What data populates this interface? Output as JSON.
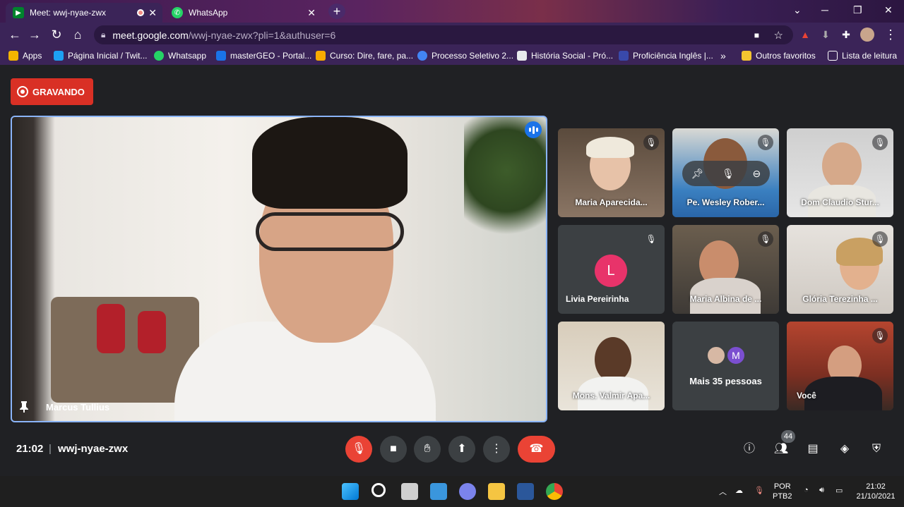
{
  "browser": {
    "tabs": [
      {
        "title": "Meet: wwj-nyae-zwx",
        "icon": "meet-icon",
        "active": true
      },
      {
        "title": "WhatsApp",
        "icon": "whatsapp-icon",
        "active": false
      }
    ],
    "url_host": "meet.google.com",
    "url_path": "/wwj-nyae-zwx?pli=1&authuser=6",
    "bookmarks": [
      {
        "label": "Apps",
        "icon": "apps-grid-icon",
        "color": "#f4b400"
      },
      {
        "label": "Página Inicial / Twit...",
        "icon": "twitter-icon",
        "color": "#1da1f2"
      },
      {
        "label": "Whatsapp",
        "icon": "whatsapp-icon",
        "color": "#25d366"
      },
      {
        "label": "masterGEO - Portal...",
        "icon": "mastergeo-icon",
        "color": "#1a73e8"
      },
      {
        "label": "Curso: Dire, fare, pa...",
        "icon": "usp-icon",
        "color": "#f9ab00"
      },
      {
        "label": "Processo Seletivo 2...",
        "icon": "drive-icon",
        "color": "#4285f4"
      },
      {
        "label": "História Social - Pró...",
        "icon": "page-icon",
        "color": "#e8eaed"
      },
      {
        "label": "Proficiência Inglês |...",
        "icon": "globe-icon",
        "color": "#3949ab"
      }
    ],
    "overflow": "»",
    "other_favorites": "Outros favoritos",
    "reading_list": "Lista de leitura"
  },
  "meet": {
    "recording_label": "GRAVANDO",
    "main_speaker": "Marcus Tullius",
    "participants": [
      {
        "name": "Maria Aparecida...",
        "muted": true
      },
      {
        "name": "Pe. Wesley Rober...",
        "muted": true
      },
      {
        "name": "Dom Claudio Stur...",
        "muted": true
      },
      {
        "name": "Livia Pereirinha",
        "muted": true,
        "avatar_letter": "L"
      },
      {
        "name": "Maria Albina de ...",
        "muted": true
      },
      {
        "name": "Glória Terezinha ...",
        "muted": true
      },
      {
        "name": "Mons. Valmir Apa...",
        "muted": false
      },
      {
        "name": "Mais 35 pessoas",
        "muted": false,
        "avatar_letter": "M"
      },
      {
        "name": "Você",
        "muted": true
      }
    ],
    "time": "21:02",
    "separator": "|",
    "meeting_code": "wwj-nyae-zwx",
    "participant_count": "44"
  },
  "taskbar": {
    "lang_top": "POR",
    "lang_bottom": "PTB2",
    "clock_time": "21:02",
    "clock_date": "21/10/2021"
  },
  "colors": {
    "accent": "#8ab4f8",
    "danger": "#ea4335",
    "recording": "#d93025"
  }
}
